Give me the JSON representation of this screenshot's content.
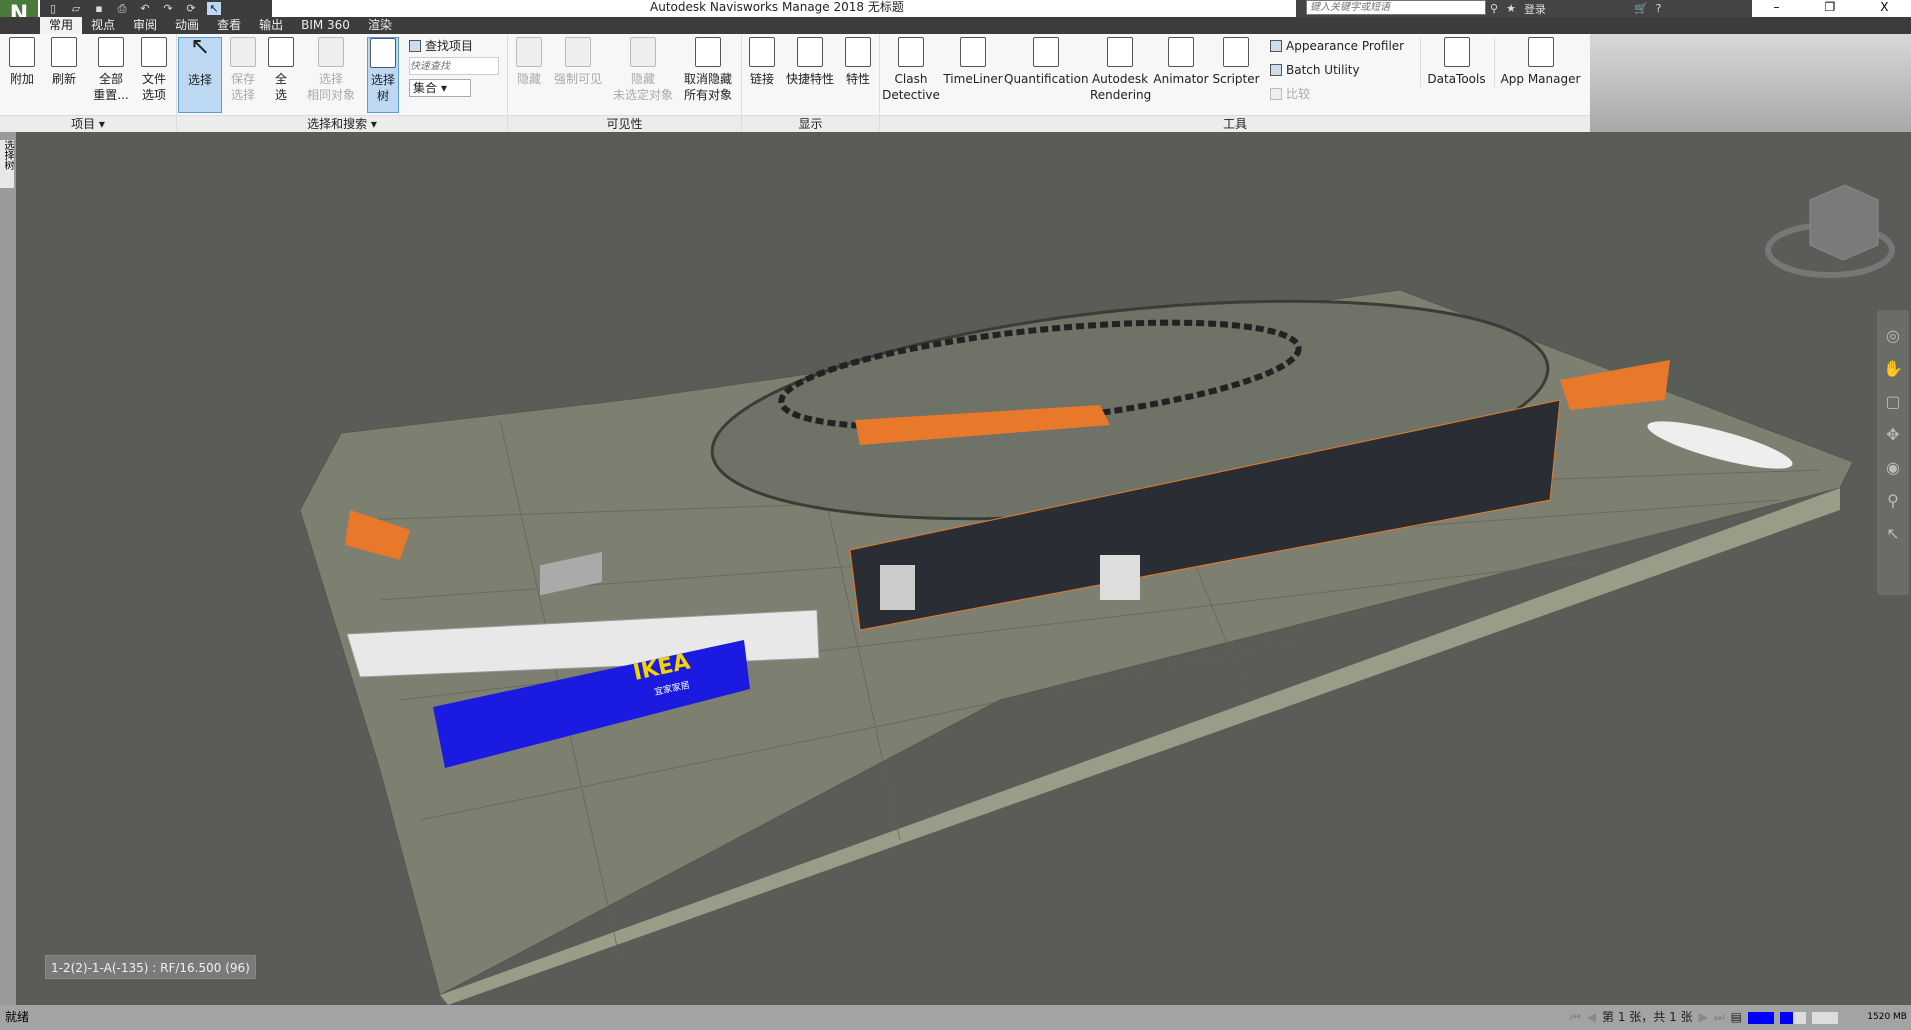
{
  "window": {
    "title": "Autodesk Navisworks Manage 2018    无标题",
    "app_letter": "N",
    "minimize": "–",
    "restore": "❐",
    "close": "X"
  },
  "quick_access": [
    "new-icon",
    "open-icon",
    "save-icon",
    "print-icon",
    "undo-icon",
    "redo-icon",
    "refresh-icon",
    "select-icon"
  ],
  "infocenter": {
    "search_placeholder": "键入关键字或短语",
    "login": "登录"
  },
  "tabs": [
    "常用",
    "视点",
    "审阅",
    "动画",
    "查看",
    "输出",
    "BIM 360",
    "渲染"
  ],
  "ribbon": {
    "project": {
      "label": "项目 ▾",
      "buttons": [
        "附加",
        "刷新",
        "全部\n重置...",
        "文件\n选项"
      ]
    },
    "select_search": {
      "label": "选择和搜索 ▾",
      "select": "选择",
      "save_select": "保存\n选择",
      "select_all": "全\n选",
      "select_same": "选择\n相同对象",
      "select_tree": "选择\n树",
      "find_items": "查找项目",
      "quick_find_placeholder": "快速查找",
      "sets": "集合"
    },
    "visibility": {
      "label": "可见性",
      "buttons": [
        "隐藏",
        "强制可见",
        "隐藏\n未选定对象",
        "取消隐藏\n所有对象"
      ]
    },
    "display": {
      "label": "显示",
      "buttons": [
        "链接",
        "快捷特性",
        "特性"
      ]
    },
    "tools": {
      "label": "工具",
      "buttons": [
        "Clash\nDetective",
        "TimeLiner",
        "Quantification",
        "Autodesk\nRendering",
        "Animator",
        "Scripter"
      ],
      "small": [
        "Appearance Profiler",
        "Batch Utility",
        "比较"
      ],
      "extra": [
        "DataTools",
        "App Manager"
      ]
    }
  },
  "side_tab": "选择树",
  "viewport": {
    "tooltip": "1-2(2)-1-A(-135) : RF/16.500 (96)",
    "ikea_text": "IKEA",
    "ikea_sub": "宜家家居",
    "colors": {
      "background": "#5a5c58",
      "platform": "#7d8070",
      "ikea_blue": "#1a1ae0",
      "accent_orange": "#e8782a"
    }
  },
  "status": {
    "text": "就绪",
    "pager": "第 1 张，共 1 张",
    "memory": "1520 MB"
  }
}
